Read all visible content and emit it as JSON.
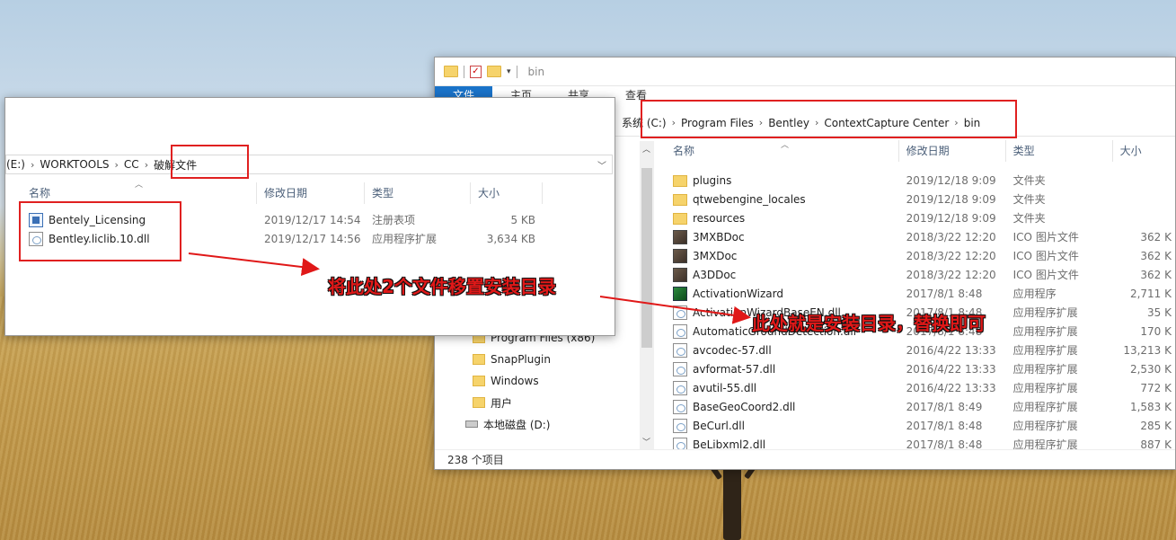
{
  "right_window": {
    "title": "bin",
    "ribbon_tabs": [
      "文件",
      "主页",
      "共享",
      "查看"
    ],
    "breadcrumb": [
      "系统 (C:)",
      "Program Files",
      "Bentley",
      "ContextCapture Center",
      "bin"
    ],
    "columns": [
      "名称",
      "修改日期",
      "类型",
      "大小"
    ],
    "files": [
      {
        "name": "plugins",
        "date": "2019/12/18 9:09",
        "type": "文件夹",
        "size": "",
        "icon": "folder-icon"
      },
      {
        "name": "qtwebengine_locales",
        "date": "2019/12/18 9:09",
        "type": "文件夹",
        "size": "",
        "icon": "folder-icon"
      },
      {
        "name": "resources",
        "date": "2019/12/18 9:09",
        "type": "文件夹",
        "size": "",
        "icon": "folder-icon"
      },
      {
        "name": "3MXBDoc",
        "date": "2018/3/22 12:20",
        "type": "ICO 图片文件",
        "size": "362 K",
        "icon": "ico-file-icon"
      },
      {
        "name": "3MXDoc",
        "date": "2018/3/22 12:20",
        "type": "ICO 图片文件",
        "size": "362 K",
        "icon": "ico-file-icon"
      },
      {
        "name": "A3DDoc",
        "date": "2018/3/22 12:20",
        "type": "ICO 图片文件",
        "size": "362 K",
        "icon": "ico-file-icon"
      },
      {
        "name": "ActivationWizard",
        "date": "2017/8/1 8:48",
        "type": "应用程序",
        "size": "2,711 K",
        "icon": "exe-icon"
      },
      {
        "name": "ActivationWizardBaseEN.dll",
        "date": "2017/8/1 8:48",
        "type": "应用程序扩展",
        "size": "35 K",
        "icon": "dll-icon"
      },
      {
        "name": "AutomaticGroundDetection.dll",
        "date": "2017/8/1 8:48",
        "type": "应用程序扩展",
        "size": "170 K",
        "icon": "dll-icon"
      },
      {
        "name": "avcodec-57.dll",
        "date": "2016/4/22 13:33",
        "type": "应用程序扩展",
        "size": "13,213 K",
        "icon": "dll-icon"
      },
      {
        "name": "avformat-57.dll",
        "date": "2016/4/22 13:33",
        "type": "应用程序扩展",
        "size": "2,530 K",
        "icon": "dll-icon"
      },
      {
        "name": "avutil-55.dll",
        "date": "2016/4/22 13:33",
        "type": "应用程序扩展",
        "size": "772 K",
        "icon": "dll-icon"
      },
      {
        "name": "BaseGeoCoord2.dll",
        "date": "2017/8/1 8:49",
        "type": "应用程序扩展",
        "size": "1,583 K",
        "icon": "dll-icon"
      },
      {
        "name": "BeCurl.dll",
        "date": "2017/8/1 8:48",
        "type": "应用程序扩展",
        "size": "285 K",
        "icon": "dll-icon"
      },
      {
        "name": "BeLibxml2.dll",
        "date": "2017/8/1 8:48",
        "type": "应用程序扩展",
        "size": "887 K",
        "icon": "dll-icon"
      }
    ],
    "nav": [
      {
        "label": "Program Files (x86)",
        "kind": "folder"
      },
      {
        "label": "SnapPlugin",
        "kind": "folder"
      },
      {
        "label": "Windows",
        "kind": "folder"
      },
      {
        "label": "用户",
        "kind": "folder"
      },
      {
        "label": "本地磁盘 (D:)",
        "kind": "drive"
      }
    ],
    "status": "238 个项目"
  },
  "left_window": {
    "breadcrumb": [
      "(E:)",
      "WORKTOOLS",
      "CC",
      "破解文件"
    ],
    "columns": [
      "名称",
      "修改日期",
      "类型",
      "大小"
    ],
    "files": [
      {
        "name": "Bentely_Licensing",
        "date": "2019/12/17 14:54",
        "type": "注册表项",
        "size": "5 KB",
        "icon": "registry-file-icon"
      },
      {
        "name": "Bentley.liclib.10.dll",
        "date": "2019/12/17 14:56",
        "type": "应用程序扩展",
        "size": "3,634 KB",
        "icon": "dll-icon"
      }
    ]
  },
  "annotations": {
    "move_files": "将此处2个文件移置安装目录",
    "install_dir": "此处就是安装目录，替换即可",
    "color": "#e01818"
  }
}
